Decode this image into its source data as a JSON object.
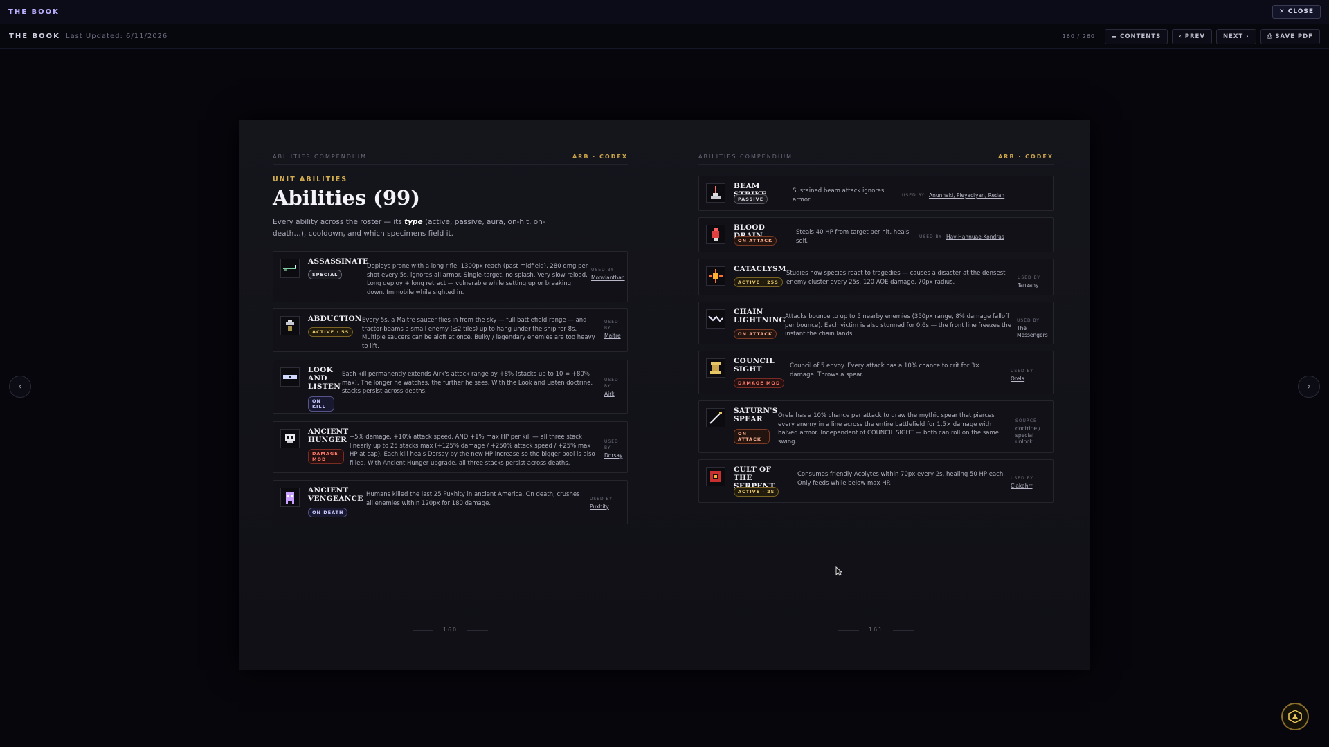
{
  "topbar": {
    "title": "THE BOOK",
    "close_label": "✕ CLOSE"
  },
  "toolbar": {
    "title": "THE BOOK",
    "updated": "Last Updated: 6/11/2026",
    "page_count": "160 / 260",
    "contents_label": "≡ CONTENTS",
    "prev_label": "‹ PREV",
    "next_label": "NEXT ›",
    "save_label": "⎙ SAVE PDF"
  },
  "left_page": {
    "header_left": "ABILITIES COMPENDIUM",
    "header_right": "ARB · CODEX",
    "section_tag": "UNIT ABILITIES",
    "title": "Abilities (99)",
    "intro_pre": "Every ability across the roster — its ",
    "intro_em": "type",
    "intro_post": " (active, passive, aura, on-hit, on-death…), cooldown, and which specimens field it.",
    "page_number": "160",
    "cards": [
      {
        "name": "ASSASSINATE",
        "badge": "SPECIAL",
        "icon": "rifle-icon",
        "desc": "Deploys prone with a long rifle. 1300px reach (past midfield), 280 dmg per shot every 5s, ignores all armor. Single-target, no splash. Very slow reload. Long deploy + long retract — vulnerable while setting up or breaking down. Immobile while sighted in.",
        "used_label": "USED BY",
        "used_by": "Moovianthan"
      },
      {
        "name": "ABDUCTION",
        "badge": "ACTIVE · 5S",
        "icon": "saucer-icon",
        "desc": "Every 5s, a Maitre saucer flies in from the sky — full battlefield range — and tractor-beams a small enemy (≤2 tiles) up to hang under the ship for 8s. Multiple saucers can be aloft at once. Bulky / legendary enemies are too heavy to lift.",
        "used_label": "USED BY",
        "used_by": "Maitre"
      },
      {
        "name": "LOOK AND LISTEN",
        "badge": "ON KILL",
        "icon": "eye-icon",
        "desc": "Each kill permanently extends Airk's attack range by +8% (stacks up to 10 = +80% max). The longer he watches, the further he sees. With the Look and Listen doctrine, stacks persist across deaths.",
        "used_label": "USED BY",
        "used_by": "Airk"
      },
      {
        "name": "ANCIENT HUNGER",
        "badge": "DAMAGE MOD",
        "icon": "skull-icon",
        "desc": "+5% damage, +10% attack speed, AND +1% max HP per kill — all three stack linearly up to 25 stacks max (+125% damage / +250% attack speed / +25% max HP at cap). Each kill heals Dorsay by the new HP increase so the bigger pool is also filled. With Ancient Hunger upgrade, all three stacks persist across deaths.",
        "used_label": "USED BY",
        "used_by": "Dorsay"
      },
      {
        "name": "ANCIENT VENGEANCE",
        "badge": "ON DEATH",
        "icon": "ghost-icon",
        "desc": "Humans killed the last 25 Puxhity in ancient America. On death, crushes all enemies within 120px for 180 damage.",
        "used_label": "USED BY",
        "used_by": "Puxhity"
      }
    ]
  },
  "right_page": {
    "header_left": "ABILITIES COMPENDIUM",
    "header_right": "ARB · CODEX",
    "page_number": "161",
    "cards": [
      {
        "name": "BEAM STRIKE",
        "badge": "PASSIVE",
        "icon": "beam-icon",
        "desc": "Sustained beam attack ignores armor.",
        "used_label": "USED BY",
        "used_by": "Anunnaki, Pleyadiyan, Redan"
      },
      {
        "name": "BLOOD DRAIN",
        "badge": "ON ATTACK",
        "icon": "drop-icon",
        "desc": "Steals 40 HP from target per hit, heals self.",
        "used_label": "USED BY",
        "used_by": "Hav-Hannuae-Kondras"
      },
      {
        "name": "CATACLYSM",
        "badge": "ACTIVE · 25S",
        "icon": "burst-icon",
        "desc": "Studies how species react to tragedies — causes a disaster at the densest enemy cluster every 25s. 120 AOE damage, 70px radius.",
        "used_label": "USED BY",
        "used_by": "Tanzany"
      },
      {
        "name": "CHAIN LIGHTNING",
        "badge": "ON ATTACK",
        "icon": "lightning-icon",
        "desc": "Attacks bounce to up to 5 nearby enemies (350px range, 8% damage falloff per bounce). Each victim is also stunned for 0.6s — the front line freezes the instant the chain lands.",
        "used_label": "USED BY",
        "used_by": "The Messengers"
      },
      {
        "name": "COUNCIL SIGHT",
        "badge": "DAMAGE MOD",
        "icon": "council-icon",
        "desc": "Council of 5 envoy. Every attack has a 10% chance to crit for 3× damage. Throws a spear.",
        "used_label": "USED BY",
        "used_by": "Orela"
      },
      {
        "name": "SATURN'S SPEAR",
        "badge": "ON ATTACK",
        "icon": "spear-icon",
        "desc": "Orela has a 10% chance per attack to draw the mythic spear that pierces every enemy in a line across the entire battlefield for 1.5× damage with halved armor. Independent of COUNCIL SIGHT — both can roll on the same swing.",
        "used_label": "SOURCE",
        "used_by": "doctrine / special unlock"
      },
      {
        "name": "CULT OF THE SERPENT",
        "badge": "ACTIVE · 2S",
        "icon": "serpent-icon",
        "desc": "Consumes friendly Acolytes within 70px every 2s, healing 50 HP each. Only feeds while below max HP.",
        "used_label": "USED BY",
        "used_by": "Ciakahrr"
      }
    ]
  },
  "nav": {
    "prev_arrow": "‹",
    "next_arrow": "›"
  },
  "colors": {
    "accent_gold": "#d4ae4f",
    "accent_purple": "#b9b0ff",
    "danger": "#ff7a6a"
  }
}
